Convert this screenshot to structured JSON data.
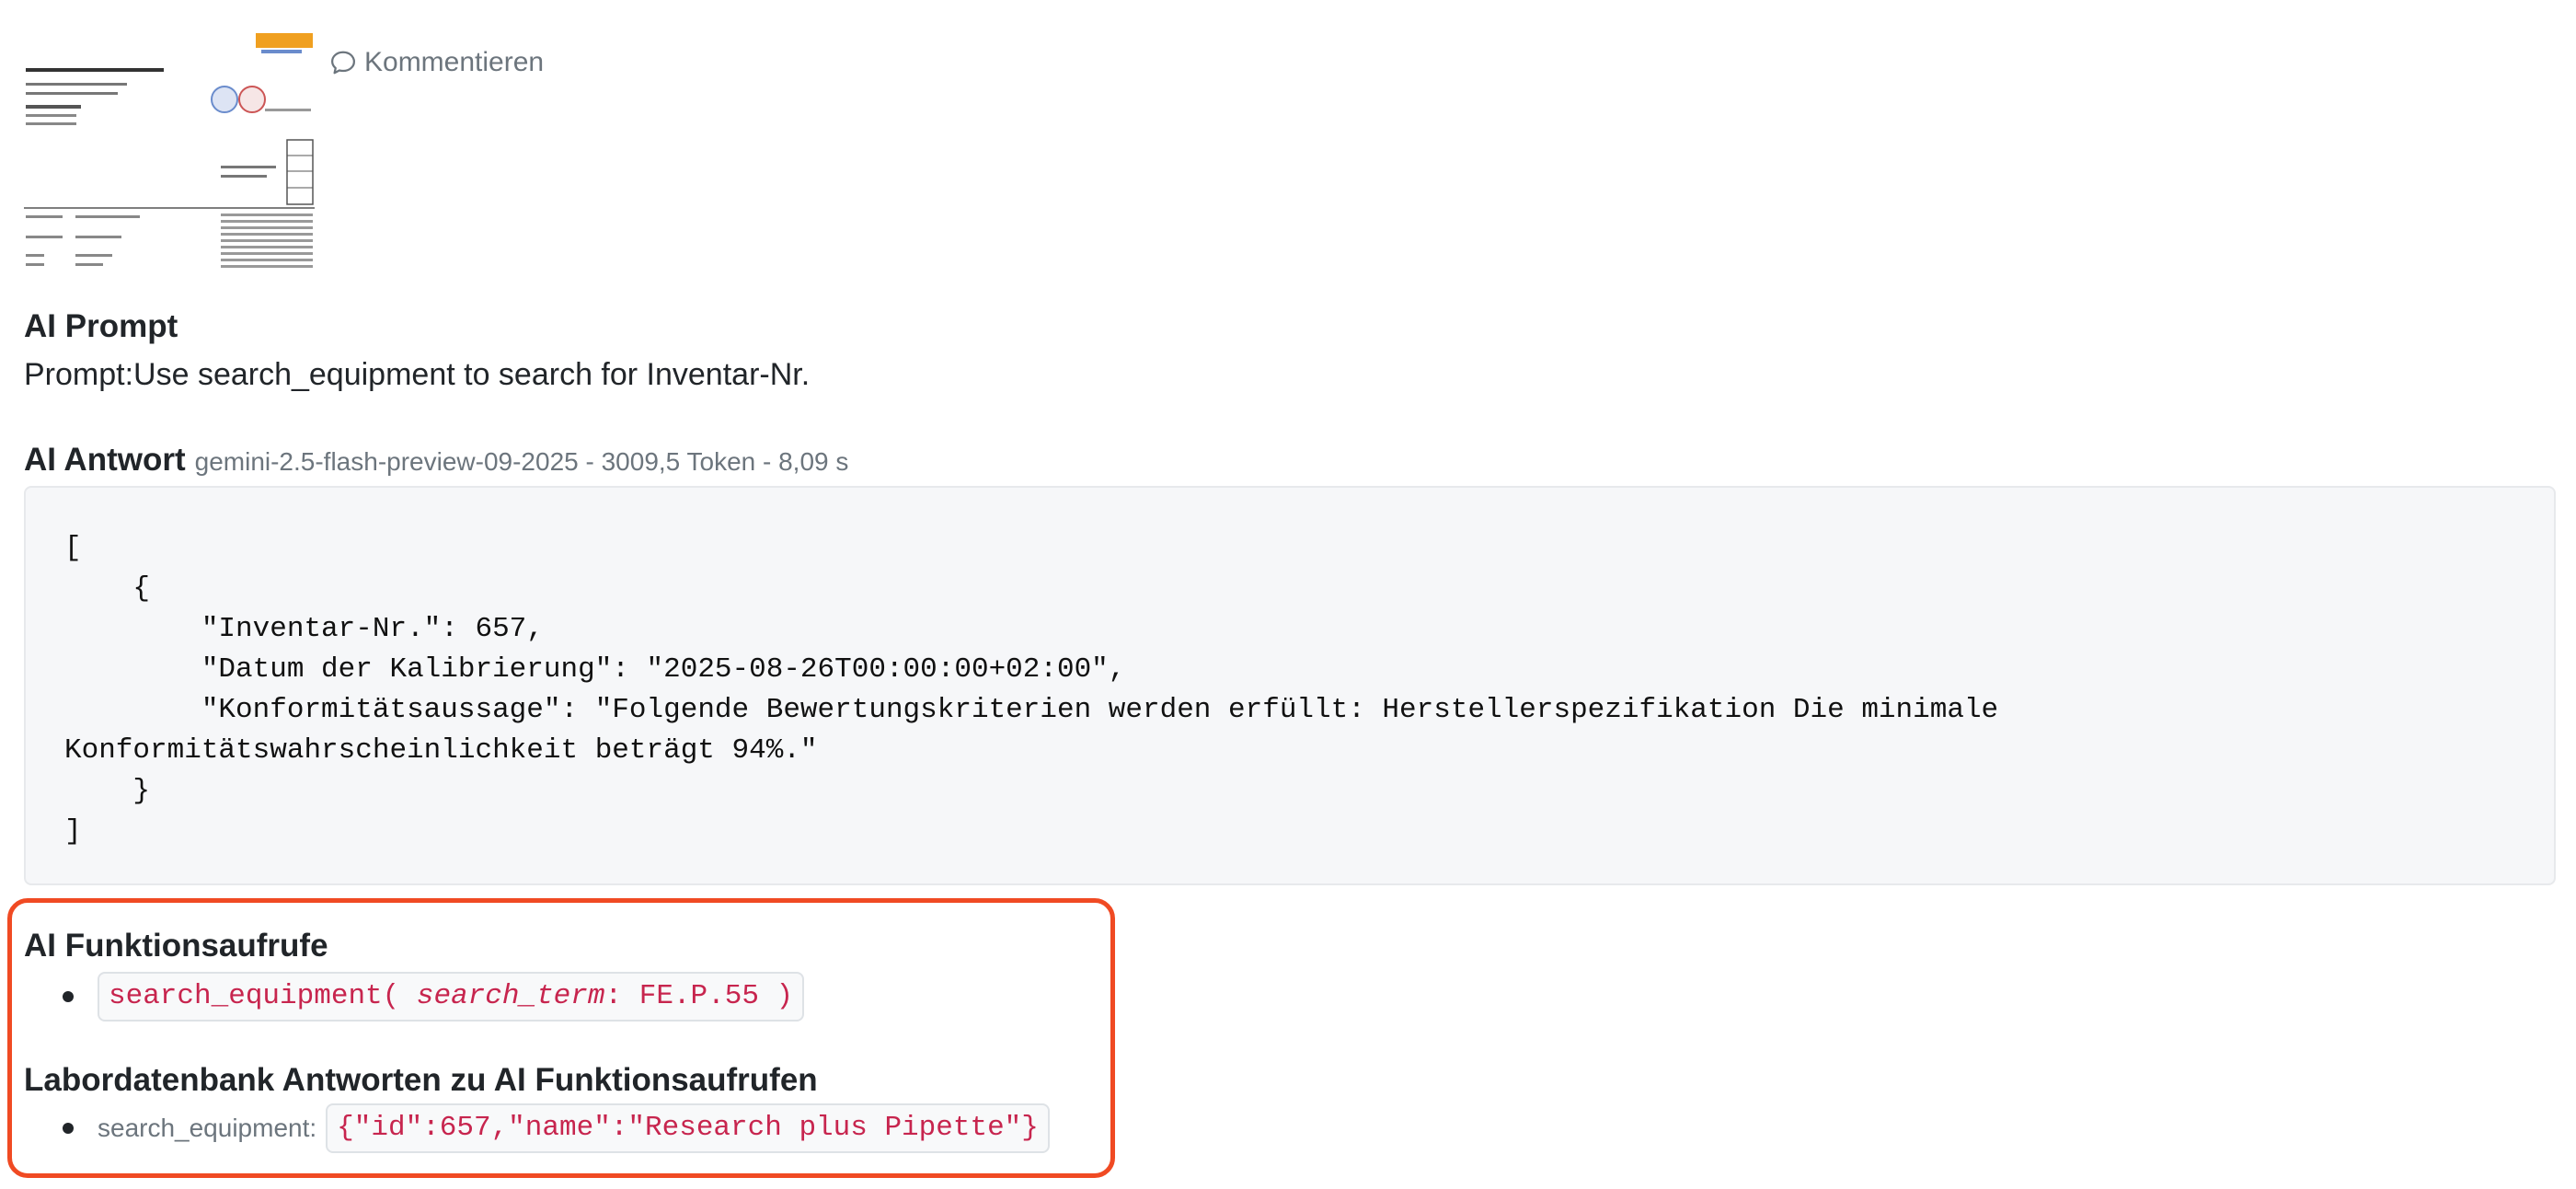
{
  "attachment": {
    "preview_name": "calibration-certificate-thumbnail",
    "comment_label": "Kommentieren",
    "comment_icon": "speech-bubble-icon"
  },
  "prompt": {
    "heading": "AI Prompt",
    "text": "Prompt:Use search_equipment to search for Inventar-Nr."
  },
  "answer": {
    "heading": "AI Antwort",
    "meta": "gemini-2.5-flash-preview-09-2025 - 3009,5 Token - 8,09 s",
    "code": "[\n    {\n        \"Inventar-Nr.\": 657,\n        \"Datum der Kalibrierung\": \"2025-08-26T00:00:00+02:00\",\n        \"Konformitätsaussage\": \"Folgende Bewertungskriterien werden erfüllt: Herstellerspezifikation Die minimale Konformitätswahrscheinlichkeit beträgt 94%.\"\n    }\n]"
  },
  "function_calls": {
    "heading": "AI Funktionsaufrufe",
    "items": [
      {
        "fn_open": "search_equipment( ",
        "param_name": "search_term",
        "param_sep": ": ",
        "param_value": "FE.P.55",
        "fn_close": " )"
      }
    ]
  },
  "db_responses": {
    "heading": "Labordatenbank Antworten zu AI Funktionsaufrufen",
    "items": [
      {
        "label": "search_equipment:",
        "value": "{\"id\":657,\"name\":\"Research plus Pipette\"}"
      }
    ]
  },
  "colors": {
    "highlight_border": "#f04a23",
    "code_pink": "#c7254e",
    "muted": "#6c757d"
  }
}
